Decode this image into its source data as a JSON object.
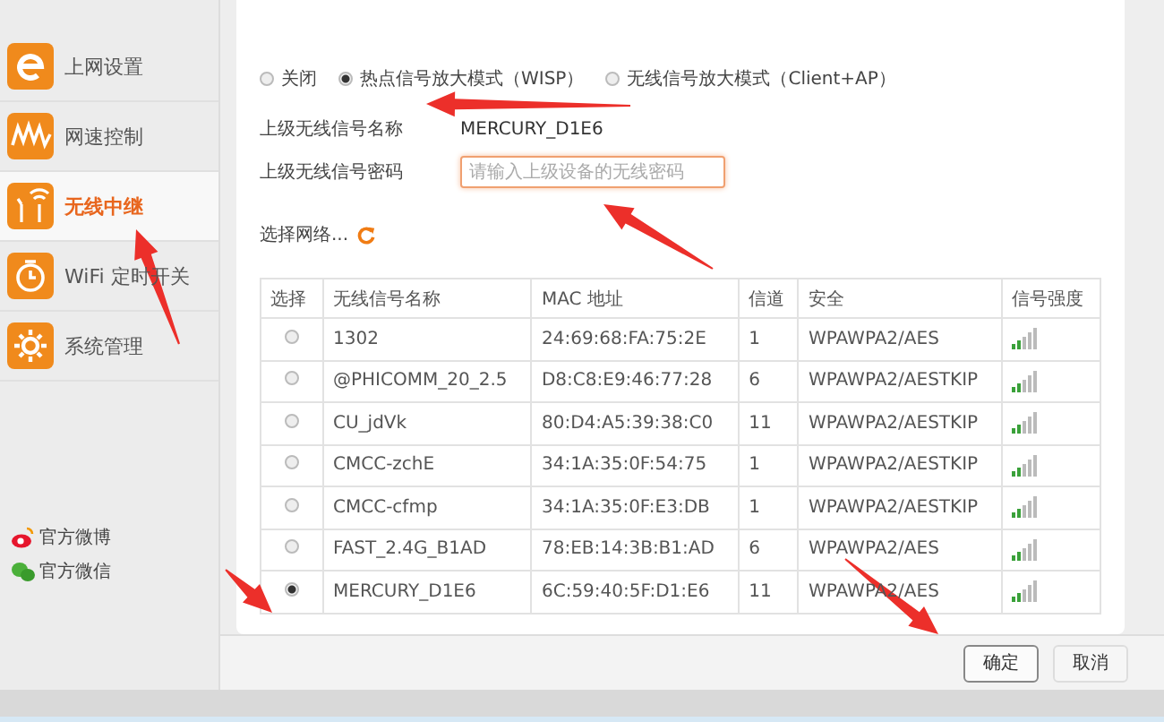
{
  "sidebar": {
    "items": [
      {
        "label": "上网设置",
        "selected": false
      },
      {
        "label": "网速控制",
        "selected": false
      },
      {
        "label": "无线中继",
        "selected": true
      },
      {
        "label": "WiFi 定时开关",
        "selected": false
      },
      {
        "label": "系统管理",
        "selected": false
      }
    ],
    "links": [
      {
        "label": "官方微博"
      },
      {
        "label": "官方微信"
      }
    ]
  },
  "modes": [
    {
      "label": "关闭",
      "selected": false
    },
    {
      "label": "热点信号放大模式（WISP）",
      "selected": true
    },
    {
      "label": "无线信号放大模式（Client+AP）",
      "selected": false
    }
  ],
  "fields": [
    {
      "label": "上级无线信号名称",
      "kind": "text",
      "value": "MERCURY_D1E6"
    },
    {
      "label": "上级无线信号密码",
      "kind": "input",
      "placeholder": "请输入上级设备的无线密码"
    }
  ],
  "select_network": {
    "label": "选择网络..."
  },
  "table": {
    "columns": [
      "选择",
      "无线信号名称",
      "MAC 地址",
      "信道",
      "安全",
      "信号强度"
    ],
    "rows": [
      {
        "selected": false,
        "name": "1302",
        "mac": "24:69:68:FA:75:2E",
        "channel": "1",
        "security": "WPAWPA2/AES"
      },
      {
        "selected": false,
        "name": "@PHICOMM_20_2.5",
        "mac": "D8:C8:E9:46:77:28",
        "channel": "6",
        "security": "WPAWPA2/AESTKIP"
      },
      {
        "selected": false,
        "name": "CU_jdVk",
        "mac": "80:D4:A5:39:38:C0",
        "channel": "11",
        "security": "WPAWPA2/AESTKIP"
      },
      {
        "selected": false,
        "name": "CMCC-zchE",
        "mac": "34:1A:35:0F:54:75",
        "channel": "1",
        "security": "WPAWPA2/AESTKIP"
      },
      {
        "selected": false,
        "name": "CMCC-cfmp",
        "mac": "34:1A:35:0F:E3:DB",
        "channel": "1",
        "security": "WPAWPA2/AESTKIP"
      },
      {
        "selected": false,
        "name": "FAST_2.4G_B1AD",
        "mac": "78:EB:14:3B:B1:AD",
        "channel": "6",
        "security": "WPAWPA2/AES"
      },
      {
        "selected": true,
        "name": "MERCURY_D1E6",
        "mac": "6C:59:40:5F:D1:E6",
        "channel": "11",
        "security": "WPAWPA2/AES"
      }
    ]
  },
  "buttons": [
    {
      "label": "确定",
      "kind": "primary"
    },
    {
      "label": "取消",
      "kind": "secondary"
    }
  ]
}
